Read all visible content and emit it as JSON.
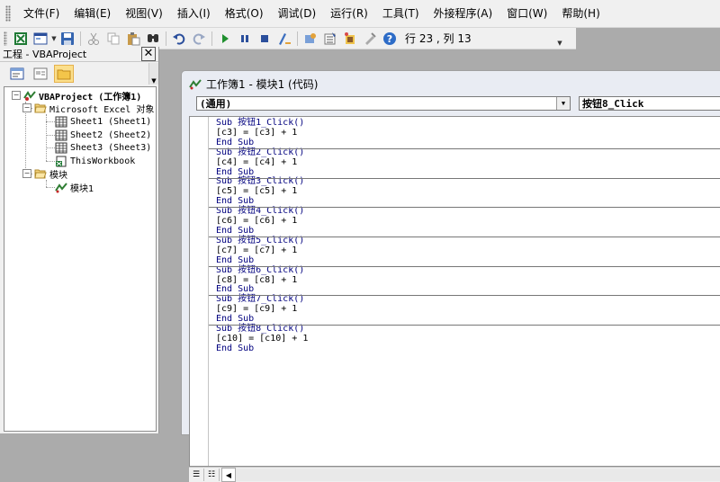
{
  "menu": [
    "文件(F)",
    "编辑(E)",
    "视图(V)",
    "插入(I)",
    "格式(O)",
    "调试(D)",
    "运行(R)",
    "工具(T)",
    "外接程序(A)",
    "窗口(W)",
    "帮助(H)"
  ],
  "toolbar": {
    "status": "行 23 , 列 13"
  },
  "project": {
    "title": "工程 - VBAProject",
    "close": "✕",
    "tree": {
      "root": "VBAProject (工作簿1)",
      "excel_folder": "Microsoft Excel 对象",
      "sheet1": "Sheet1 (Sheet1)",
      "sheet2": "Sheet2 (Sheet2)",
      "sheet3": "Sheet3 (Sheet3)",
      "workbook": "ThisWorkbook",
      "module_folder": "模块",
      "module1": "模块1"
    }
  },
  "code_window": {
    "title": "工作簿1 - 模块1 (代码)",
    "object_combo": "(通用)",
    "proc_combo": "按钮8_Click",
    "procedures": [
      {
        "sub": "Sub 按钮1_Click()",
        "body": "[c3] = [c3] + 1",
        "end": "End Sub"
      },
      {
        "sub": "Sub 按钮2_Click()",
        "body": "[c4] = [c4] + 1",
        "end": "End Sub"
      },
      {
        "sub": "Sub 按钮3_Click()",
        "body": "[c5] = [c5] + 1",
        "end": "End Sub"
      },
      {
        "sub": "Sub 按钮4_Click()",
        "body": "[c6] = [c6] + 1",
        "end": "End Sub"
      },
      {
        "sub": "Sub 按钮5_Click()",
        "body": "[c7] = [c7] + 1",
        "end": "End Sub"
      },
      {
        "sub": "Sub 按钮6_Click()",
        "body": "[c8] = [c8] + 1",
        "end": "End Sub"
      },
      {
        "sub": "Sub 按钮7_Click()",
        "body": "[c9] = [c9] + 1",
        "end": "End Sub"
      },
      {
        "sub": "Sub 按钮8_Click()",
        "body": "[c10] = [c10] + 1",
        "end": "End Sub"
      }
    ]
  },
  "colors": {
    "keyword": "#00007f",
    "selected_tool": "#fbdf8c"
  }
}
